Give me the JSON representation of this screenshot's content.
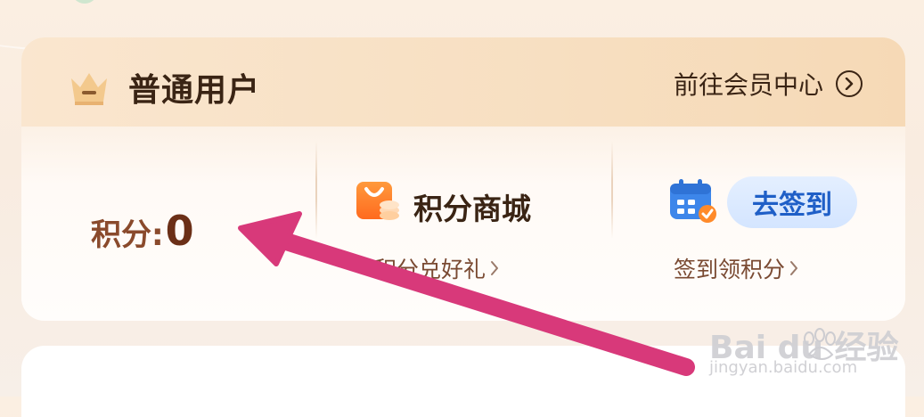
{
  "header": {
    "member_level": "普通用户",
    "member_center_link": "前往会员中心"
  },
  "points": {
    "label": "积分:",
    "value": "0"
  },
  "mall": {
    "title": "积分商城",
    "subtitle": "积分兑好礼"
  },
  "signin": {
    "button_label": "去签到",
    "subtitle": "签到领积分"
  },
  "watermark": {
    "logo_text": "Bai du 经验",
    "url": "jingyan.baidu.com"
  },
  "icons": {
    "crown": "crown-icon",
    "member_arrow": "chevron-right-circle-icon",
    "mall": "shopping-bag-icon",
    "calendar": "calendar-check-icon",
    "sub_chevron": "chevron-right-icon"
  },
  "colors": {
    "header_bg": "#f7dfc1",
    "points_text": "#8a4a2c",
    "signin_button_bg": "#d4e5ff",
    "signin_button_text": "#1f5fc7",
    "annotation_arrow": "#d8397a"
  }
}
